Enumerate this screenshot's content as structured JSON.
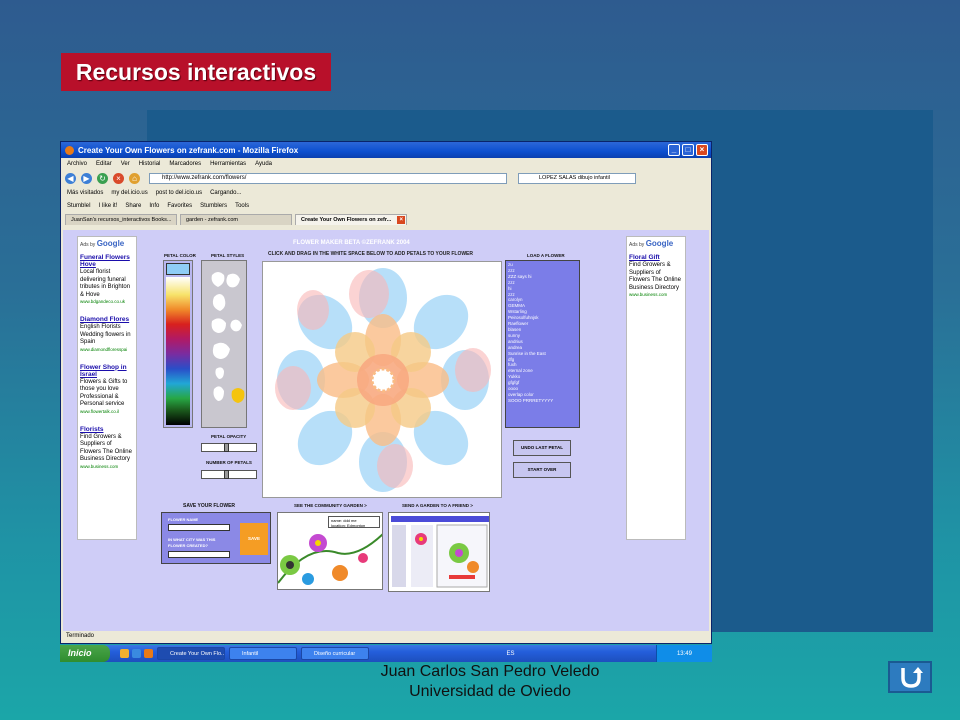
{
  "slide": {
    "title": "Recursos interactivos",
    "footer_line1": "Juan Carlos San Pedro Veledo",
    "footer_line2": "Universidad de Oviedo"
  },
  "browser": {
    "window_title": "Create Your Own Flowers on zefrank.com - Mozilla Firefox",
    "menu": [
      "Archivo",
      "Editar",
      "Ver",
      "Historial",
      "Marcadores",
      "Herramientas",
      "Ayuda"
    ],
    "url": "http://www.zefrank.com/flowers/",
    "search": "LOPEZ SALAS dibujo infantil",
    "bookmarks": [
      "Más visitados",
      "my del.icio.us",
      "post to del.icio.us",
      "Cargando..."
    ],
    "stumble_bar": [
      "StumbleI",
      "I like it!",
      "Share",
      "Info",
      "Favorites",
      "Stumblers",
      "Tools"
    ],
    "tabs": [
      "JuanSan's recursos_interactivos Books...",
      "garden - zefrank.com",
      "Create Your Own Flowers on zefr..."
    ],
    "status": "Terminado"
  },
  "ads_left": {
    "adsby": "Ads by",
    "google": "Google",
    "items": [
      {
        "headline": "Funeral Flowers Hove",
        "body": "Local florist delivering funeral tributes in Brighton & Hove",
        "url": "www.bdgandeco.co.uk"
      },
      {
        "headline": "Diamond Flores",
        "body": "English Florists Wedding flowers in Spain",
        "url": "www.diamondfloresspai"
      },
      {
        "headline": "Flower Shop in Israel",
        "body": "Flowers & Gifts to those you love Professional & Personal service",
        "url": "www.flowertalk.co.il"
      },
      {
        "headline": "Florists",
        "body": "Find Growers & Suppliers of Flowers The Online Business Directory",
        "url": "www.business.com"
      }
    ]
  },
  "ads_right": {
    "adsby": "Ads by",
    "google": "Google",
    "items": [
      {
        "headline": "Floral Gift",
        "body": "Find Growers & Suppliers of Flowers The Online Business Directory",
        "url": "www.business.com"
      }
    ]
  },
  "app": {
    "title": "FLOWER MAKER BETA ©ZEFRANK 2004",
    "subtitle": "CLICK AND DRAG IN THE WHITE SPACE BELOW TO ADD PETALS TO YOUR FLOWER",
    "petal_color": "PETAL COLOR",
    "petal_styles": "PETAL STYLES",
    "load_flower": "LOAD A FLOWER",
    "petal_opacity": "PETAL OPACITY",
    "number_of_petals": "NUMBER OF PETALS",
    "undo": "UNDO LAST PETAL",
    "start_over": "START OVER",
    "save_title": "SAVE YOUR FLOWER",
    "flower_name": "FLOWER NAME",
    "city_q1": "IN WHAT CITY WAS THIS",
    "city_q2": "FLOWER CREATED?",
    "save_btn": "SAVE",
    "community": "SEE THE COMMUNITY GARDEN >",
    "send": "SEND A GARDEN TO A FRIEND >",
    "thumb_name": "name: ddd me",
    "thumb_location": "location: Edmonton",
    "selected_color": "#8fcdf6",
    "opacity_value": "",
    "petals_value": "",
    "load_list": [
      "zu",
      "zzz",
      "ZZZ says hi",
      "zzz",
      "hi",
      "zzz",
      "carolyn",
      "GEMMA",
      "Wstarling",
      "Peirosolfuhnjsk",
      "Raeflower",
      "blasen",
      "sunny",
      "andrius",
      "andrea",
      "Sunrise in the East",
      "dfg",
      "fuxh",
      "eternal zone",
      "Yukko",
      "gfgfgf",
      "oooo",
      "overlap color",
      "SOOO PRRRETYYYY"
    ]
  },
  "taskbar": {
    "start": "Inicio",
    "tasks": [
      "Create Your Own Flo...",
      "Infantil",
      "Diseño curricular"
    ],
    "lang": "ES",
    "time": "13:49"
  }
}
